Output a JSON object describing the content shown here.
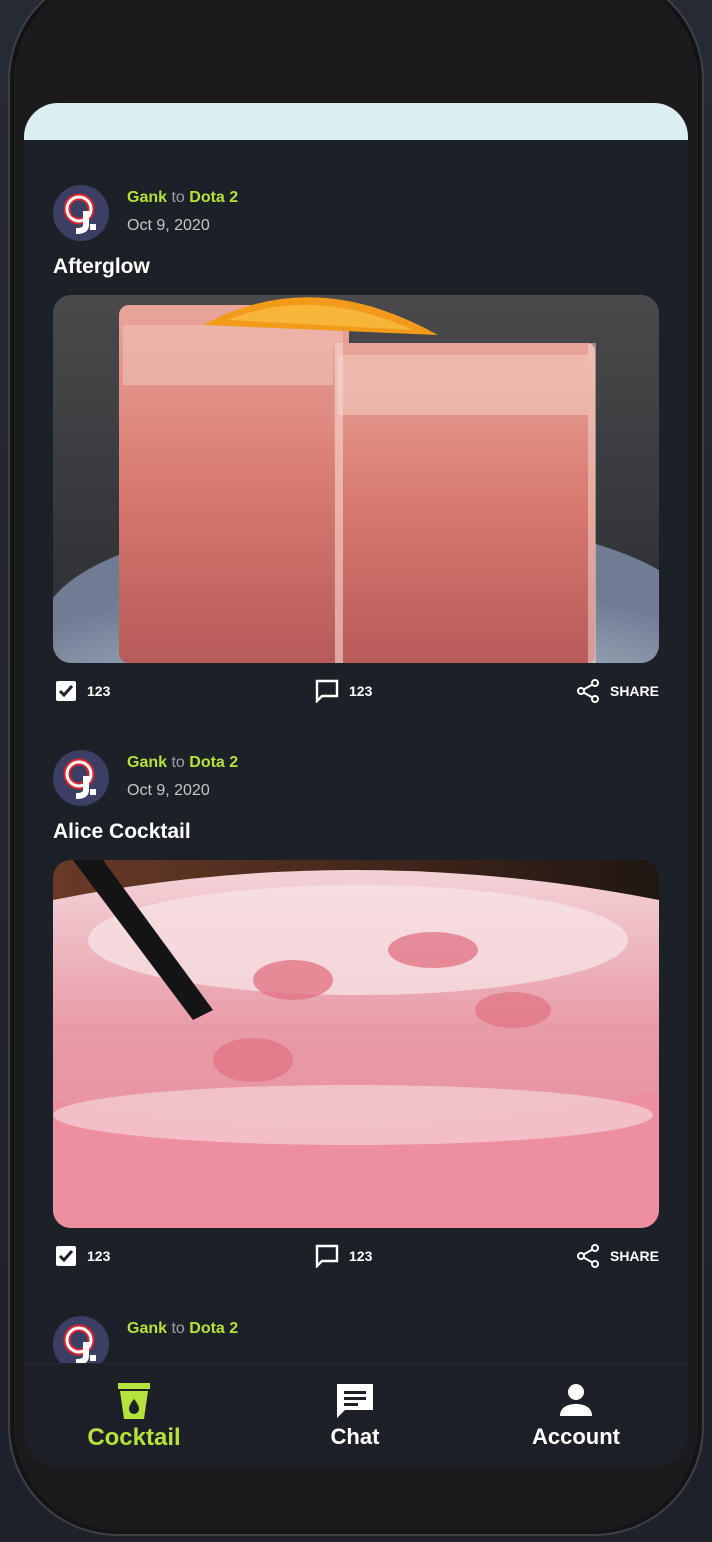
{
  "colors": {
    "accent": "#b6e23c",
    "background": "#1c2027",
    "top_banner": "#dceff0",
    "text": "#ffffff",
    "muted": "#9aa0a8"
  },
  "feed": {
    "posts": [
      {
        "author": "Gank",
        "connector": "to",
        "group": "Dota 2",
        "date": "Oct 9, 2020",
        "title": "Afterglow",
        "likes": "123",
        "comments": "123",
        "share_label": "SHARE"
      },
      {
        "author": "Gank",
        "connector": "to",
        "group": "Dota 2",
        "date": "Oct 9, 2020",
        "title": "Alice Cocktail",
        "likes": "123",
        "comments": "123",
        "share_label": "SHARE"
      },
      {
        "author": "Gank",
        "connector": "to",
        "group": "Dota 2"
      }
    ]
  },
  "nav": {
    "items": [
      {
        "label": "Cocktail",
        "icon": "cocktail-glass-icon",
        "active": true
      },
      {
        "label": "Chat",
        "icon": "chat-bubble-icon",
        "active": false
      },
      {
        "label": "Account",
        "icon": "person-icon",
        "active": false
      }
    ]
  }
}
